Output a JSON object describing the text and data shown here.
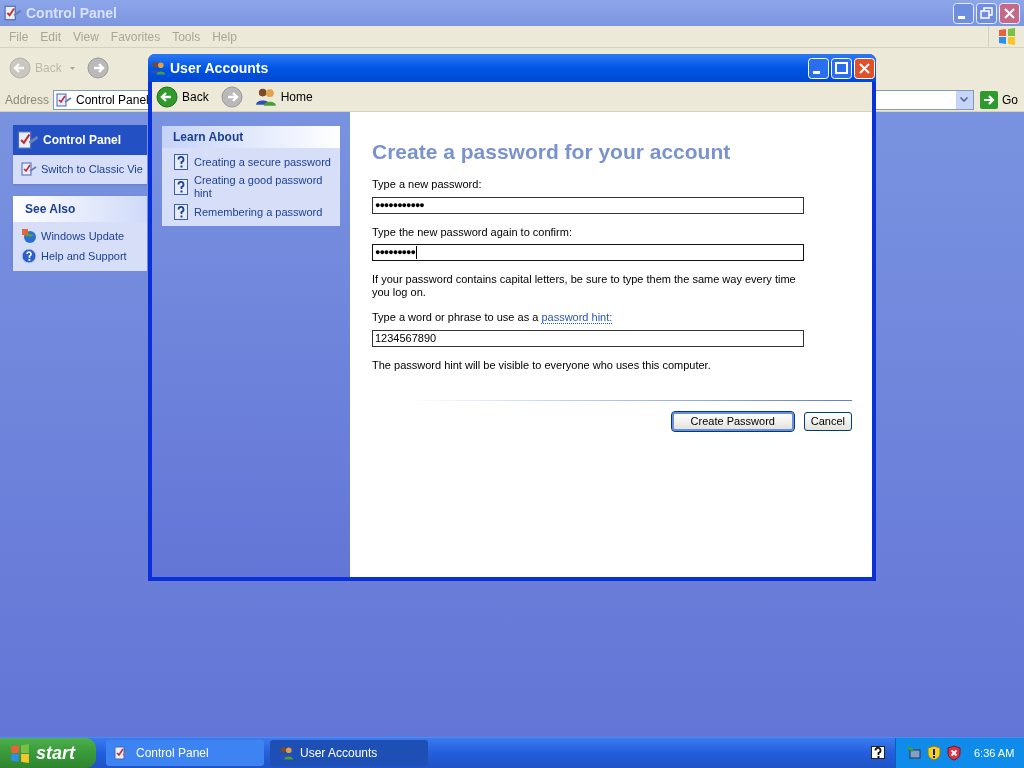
{
  "background_window": {
    "title": "Control Panel",
    "menu": [
      "File",
      "Edit",
      "View",
      "Favorites",
      "Tools",
      "Help"
    ],
    "toolbar": {
      "back": "Back"
    },
    "address": {
      "label": "Address",
      "value": "Control Panel",
      "go": "Go"
    },
    "panels": [
      {
        "title": "Control Panel",
        "kind": "header",
        "items": [
          "Switch to Classic Vie"
        ]
      },
      {
        "title": "See Also",
        "kind": "plain",
        "items": [
          "Windows Update",
          "Help and Support"
        ]
      }
    ]
  },
  "dialog": {
    "title": "User Accounts",
    "toolbar": {
      "back": "Back",
      "home": "Home"
    },
    "learn_about": {
      "title": "Learn About",
      "items": [
        "Creating a secure password",
        "Creating a good password hint",
        "Remembering a password"
      ]
    },
    "heading": "Create a password for your account",
    "fields": [
      {
        "label": "Type a new password:",
        "value": "●●●●●●●●●●●",
        "focused": false
      },
      {
        "label": "Type the new password again to confirm:",
        "value": "●●●●●●●●●",
        "focused": true,
        "note": "If your password contains capital letters, be sure to type them the same way every time you log on."
      },
      {
        "label": "Type a word or phrase to use as a",
        "link": "password hint:",
        "value": "1234567890",
        "focused": false,
        "note": "The password hint will be visible to everyone who uses this computer."
      }
    ],
    "buttons": [
      {
        "label": "Create Password",
        "default": true
      },
      {
        "label": "Cancel",
        "default": false
      }
    ]
  },
  "taskbar": {
    "start": "start",
    "tasks": [
      {
        "label": "Control Panel",
        "selected": false
      },
      {
        "label": "User Accounts",
        "selected": true
      }
    ],
    "clock": "6:36 AM"
  }
}
